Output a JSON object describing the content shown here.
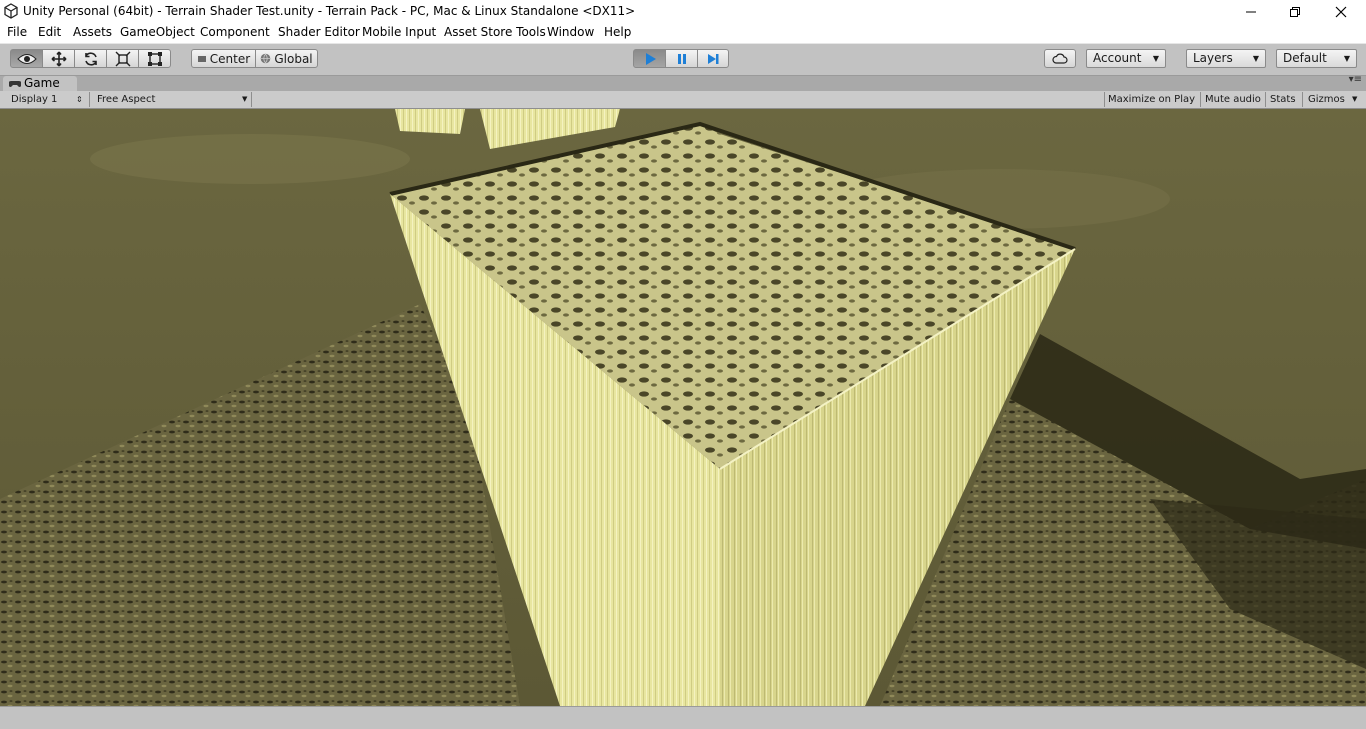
{
  "window": {
    "title": "Unity Personal (64bit) - Terrain Shader Test.unity - Terrain Pack - PC, Mac & Linux Standalone <DX11>",
    "controls": [
      "minimize-icon",
      "maximize-icon",
      "close-icon"
    ]
  },
  "menu": [
    "File",
    "Edit",
    "Assets",
    "GameObject",
    "Component",
    "Shader Editor",
    "Mobile Input",
    "Asset Store Tools",
    "Window",
    "Help"
  ],
  "toolbar": {
    "tools": [
      "view-tool-icon",
      "move-tool-icon",
      "rotate-tool-icon",
      "scale-tool-icon",
      "rect-tool-icon"
    ],
    "pivot": "Center",
    "space": "Global",
    "play_state": "playing",
    "account": "Account",
    "layers": "Layers",
    "layout": "Default"
  },
  "game_view": {
    "tab_label": "Game",
    "display": "Display 1",
    "aspect": "Free Aspect",
    "maximize_on_play": "Maximize on Play",
    "mute_audio": "Mute audio",
    "stats": "Stats",
    "gizmos": "Gizmos"
  },
  "colors": {
    "play_accent": "#1e7fd6",
    "terrain": "#5a5533",
    "pillar": "#e8e6a0"
  }
}
